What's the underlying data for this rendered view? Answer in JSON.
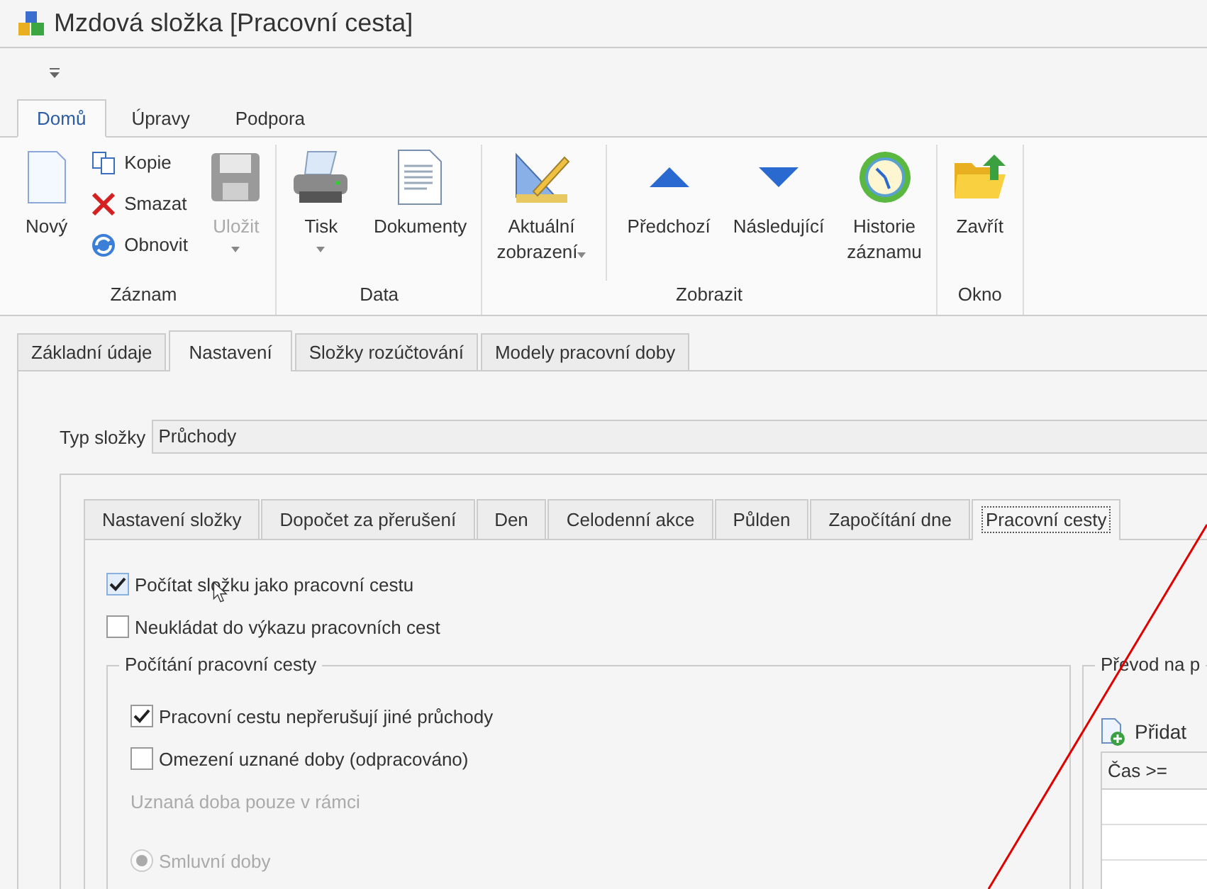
{
  "window": {
    "title": "Mzdová složka [Pracovní cesta]"
  },
  "ribbon": {
    "tabs": [
      {
        "label": "Domů",
        "selected": true
      },
      {
        "label": "Úpravy",
        "selected": false
      },
      {
        "label": "Podpora",
        "selected": false
      }
    ],
    "groups": [
      {
        "label": "Záznam",
        "items": [
          {
            "kind": "large",
            "lines": [
              "Nový"
            ],
            "disabled": false,
            "dropdown": false
          },
          {
            "kind": "stack",
            "buttons": [
              {
                "label": "Kopie"
              },
              {
                "label": "Smazat"
              },
              {
                "label": "Obnovit"
              }
            ]
          },
          {
            "kind": "large",
            "lines": [
              "Uložit"
            ],
            "disabled": true,
            "dropdown": true
          }
        ]
      },
      {
        "label": "Data",
        "items": [
          {
            "kind": "large",
            "lines": [
              "Tisk"
            ],
            "disabled": false,
            "dropdown": true
          },
          {
            "kind": "large",
            "lines": [
              "Dokumenty"
            ],
            "disabled": false,
            "dropdown": false
          }
        ]
      },
      {
        "label": "Zobrazit",
        "items": [
          {
            "kind": "large",
            "lines": [
              "Aktuální",
              "zobrazení"
            ],
            "disabled": false,
            "dropdown": true
          },
          {
            "kind": "separator"
          },
          {
            "kind": "large",
            "lines": [
              "Předchozí"
            ],
            "disabled": false,
            "dropdown": false
          },
          {
            "kind": "large",
            "lines": [
              "Následující"
            ],
            "disabled": false,
            "dropdown": false
          },
          {
            "kind": "large",
            "lines": [
              "Historie",
              "záznamu"
            ],
            "disabled": false,
            "dropdown": false
          }
        ]
      },
      {
        "label": "Okno",
        "items": [
          {
            "kind": "large",
            "lines": [
              "Zavřít"
            ],
            "disabled": false,
            "dropdown": false
          }
        ]
      }
    ]
  },
  "main_tabs": [
    {
      "label": "Základní údaje",
      "selected": false
    },
    {
      "label": "Nastavení",
      "selected": true
    },
    {
      "label": "Složky rozúčtování",
      "selected": false
    },
    {
      "label": "Modely pracovní doby",
      "selected": false
    }
  ],
  "type_field": {
    "label": "Typ složky",
    "value": "Průchody"
  },
  "inner_tabs": [
    {
      "label": "Nastavení složky",
      "selected": false
    },
    {
      "label": "Dopočet za přerušení",
      "selected": false
    },
    {
      "label": "Den",
      "selected": false
    },
    {
      "label": "Celodenní akce",
      "selected": false
    },
    {
      "label": "Půlden",
      "selected": false
    },
    {
      "label": "Započítání dne",
      "selected": false
    },
    {
      "label": "Pracovní cesty",
      "selected": true
    }
  ],
  "options": [
    {
      "label": "Počítat složku jako pracovní cestu",
      "checked": true
    },
    {
      "label": "Neukládat do výkazu pracovních cest",
      "checked": false
    }
  ],
  "calc_group": {
    "title": "Počítání pracovní cesty",
    "options": [
      {
        "label": "Pracovní cestu nepřerušují jiné průchody",
        "checked": true
      },
      {
        "label": "Omezení uznané doby (odpracováno)",
        "checked": false
      }
    ],
    "hint": "Uznaná doba pouze v rámci",
    "radios": [
      {
        "label": "Smluvní doby",
        "selected": true,
        "disabled": true
      }
    ]
  },
  "convert_group": {
    "title": "Převod na p",
    "add_button": "Přidat",
    "columns": [
      "Čas >="
    ]
  }
}
